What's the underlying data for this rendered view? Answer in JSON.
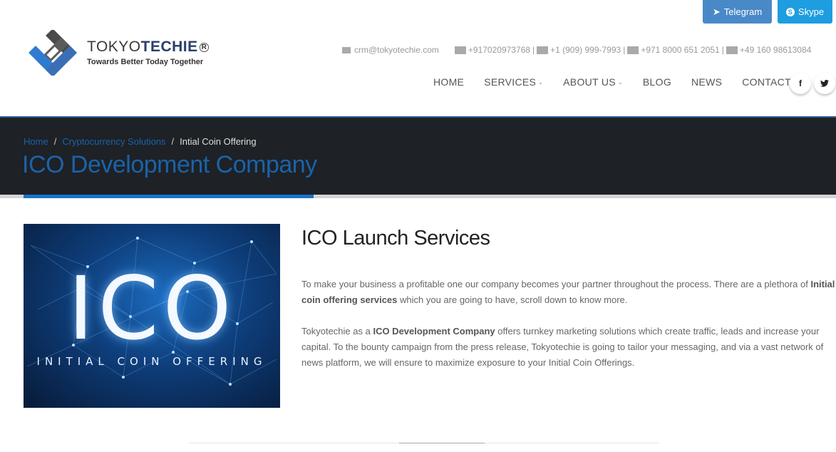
{
  "top_buttons": {
    "telegram": "Telegram",
    "skype": "Skype"
  },
  "logo": {
    "name_part1": "TOKYO",
    "name_part2": "TECHIE",
    "reg": "R",
    "tagline": "Towards Better Today Together"
  },
  "contact": {
    "email": "crm@tokyotechie.com",
    "phones": [
      "+917020973768",
      "+1 (909) 999-7993",
      "+971 8000 651 2051",
      "+49 160 98613084"
    ],
    "separator": "|"
  },
  "nav": {
    "items": [
      {
        "label": "HOME",
        "dropdown": false
      },
      {
        "label": "SERVICES",
        "dropdown": true
      },
      {
        "label": "ABOUT US",
        "dropdown": true
      },
      {
        "label": "BLOG",
        "dropdown": false
      },
      {
        "label": "NEWS",
        "dropdown": false
      },
      {
        "label": "CONTACT",
        "dropdown": false
      }
    ],
    "social": {
      "facebook": "f",
      "twitter": "t"
    }
  },
  "hero": {
    "breadcrumb": {
      "home": "Home",
      "section": "Cryptocurrency Solutions",
      "current": "Intial Coin Offering",
      "sep": "/"
    },
    "title": "ICO Development Company"
  },
  "image": {
    "word": "ICO",
    "subtitle": "INITIAL COIN OFFERING"
  },
  "content": {
    "heading": "ICO Launch Services",
    "p1_a": "To make your business a profitable one our company becomes your partner throughout the process. There are a plethora of ",
    "p1_b": "Initial coin offering services",
    "p1_c": " which you are going to have, scroll down to know more.",
    "p2_a": "Tokyotechie as a ",
    "p2_b": "ICO Development Company",
    "p2_c": " offers turnkey marketing solutions which create traffic, leads and increase your capital. To the bounty campaign from the press release, Tokyotechie is going to tailor your messaging, and via a vast network of news platform, we will ensure to maximize exposure to your Initial Coin Offerings."
  },
  "colors": {
    "accent": "#1a73c8",
    "hero_bg": "#1e2126",
    "telegram": "#4a89c8",
    "skype": "#1e9de0"
  }
}
